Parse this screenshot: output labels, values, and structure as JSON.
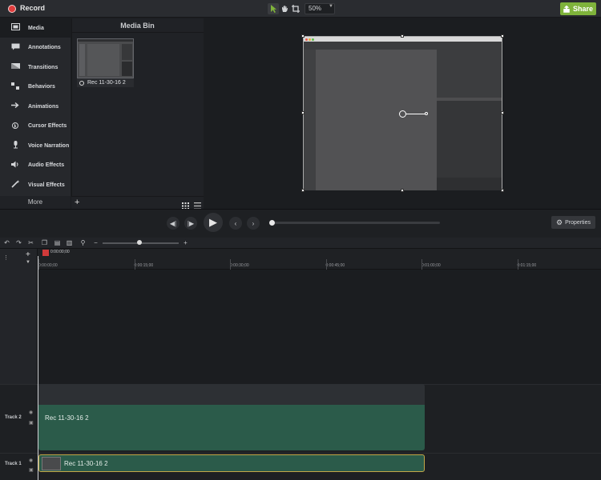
{
  "topbar": {
    "record_label": "Record",
    "zoom_value": "50%",
    "share_label": "Share",
    "tools": [
      "arrow-select-icon",
      "hand-pan-icon",
      "crop-icon"
    ]
  },
  "leftnav": {
    "items": [
      {
        "label": "Media",
        "icon": "film-icon"
      },
      {
        "label": "Annotations",
        "icon": "speech-bubble-icon"
      },
      {
        "label": "Transitions",
        "icon": "transition-icon"
      },
      {
        "label": "Behaviors",
        "icon": "behaviors-icon"
      },
      {
        "label": "Animations",
        "icon": "arrow-right-icon"
      },
      {
        "label": "Cursor Effects",
        "icon": "cursor-icon"
      },
      {
        "label": "Voice Narration",
        "icon": "microphone-icon"
      },
      {
        "label": "Audio Effects",
        "icon": "speaker-icon"
      },
      {
        "label": "Visual Effects",
        "icon": "wand-icon"
      }
    ],
    "more_label": "More"
  },
  "mediabin": {
    "title": "Media Bin",
    "clip_name": "Rec 11-30-16 2"
  },
  "player": {
    "properties_label": "Properties",
    "progress": 0
  },
  "timeline": {
    "playhead_time": "0:00:00;00",
    "ticks": [
      "0:00:00;00",
      "0:00:15;00",
      "0:00:30;00",
      "0:00:45;00",
      "0:01:00;00",
      "0:01:15;00"
    ],
    "tracks": [
      {
        "label": "Track 2",
        "clip": "Rec 11-30-16 2"
      },
      {
        "label": "Track 1",
        "clip": "Rec 11-30-16 2"
      }
    ]
  },
  "colors": {
    "accent": "#7fb33b",
    "record": "#e13d3d",
    "clip": "#2b5b4a",
    "clip_selected_border": "#c4a848"
  }
}
